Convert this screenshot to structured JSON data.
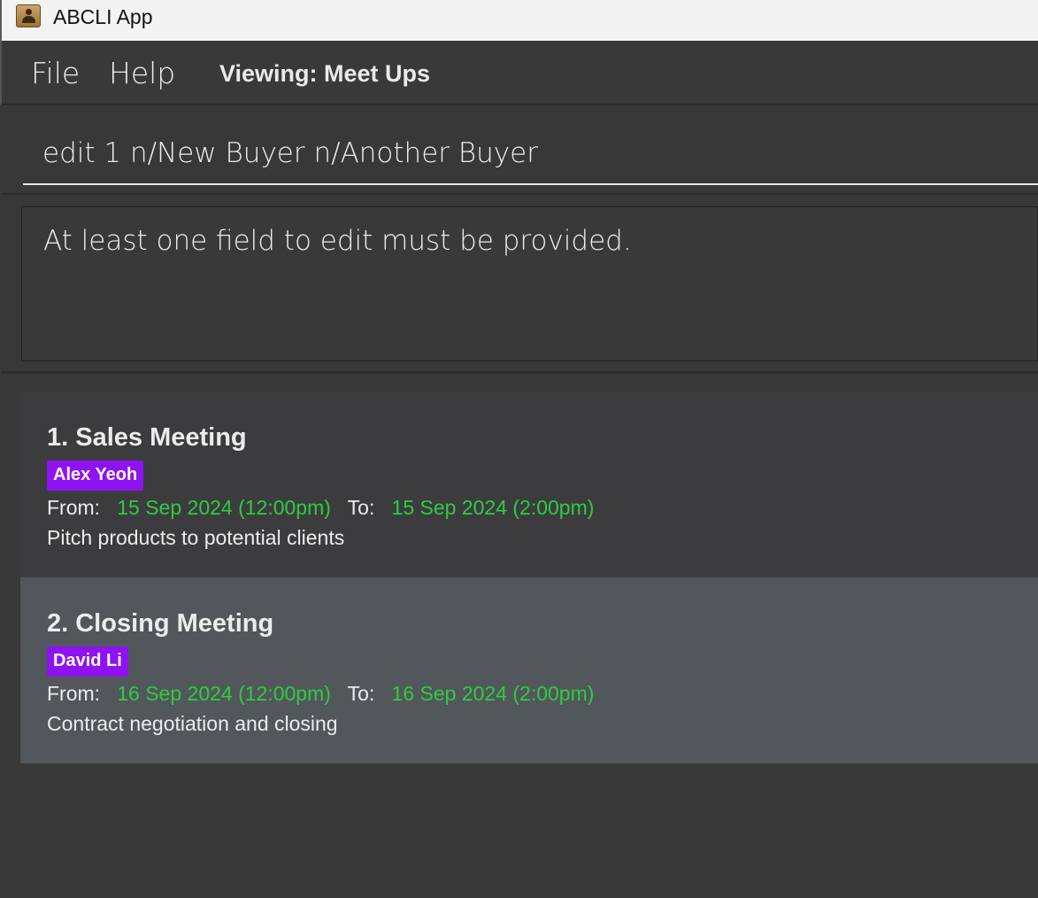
{
  "window": {
    "title": "ABCLI App",
    "icon": "address-book-icon"
  },
  "menu": {
    "file": "File",
    "help": "Help",
    "viewing": "Viewing: Meet Ups"
  },
  "command": {
    "value": "edit 1 n/New Buyer n/Another Buyer"
  },
  "result": {
    "message": "At least one field to edit must be provided."
  },
  "colors": {
    "tag": "#8f12f0",
    "time": "#2ecc40",
    "selected_card": "#52575b"
  },
  "meetups": [
    {
      "title": "1. Sales Meeting",
      "buyer": "Alex Yeoh",
      "from_label": "From:",
      "from": "15 Sep 2024 (12:00pm)",
      "to_label": "To:",
      "to": "15 Sep 2024 (2:00pm)",
      "description": "Pitch products to potential clients"
    },
    {
      "title": "2. Closing Meeting",
      "buyer": "David Li",
      "from_label": "From:",
      "from": "16 Sep 2024 (12:00pm)",
      "to_label": "To:",
      "to": "16 Sep 2024 (2:00pm)",
      "description": "Contract negotiation and closing"
    }
  ]
}
